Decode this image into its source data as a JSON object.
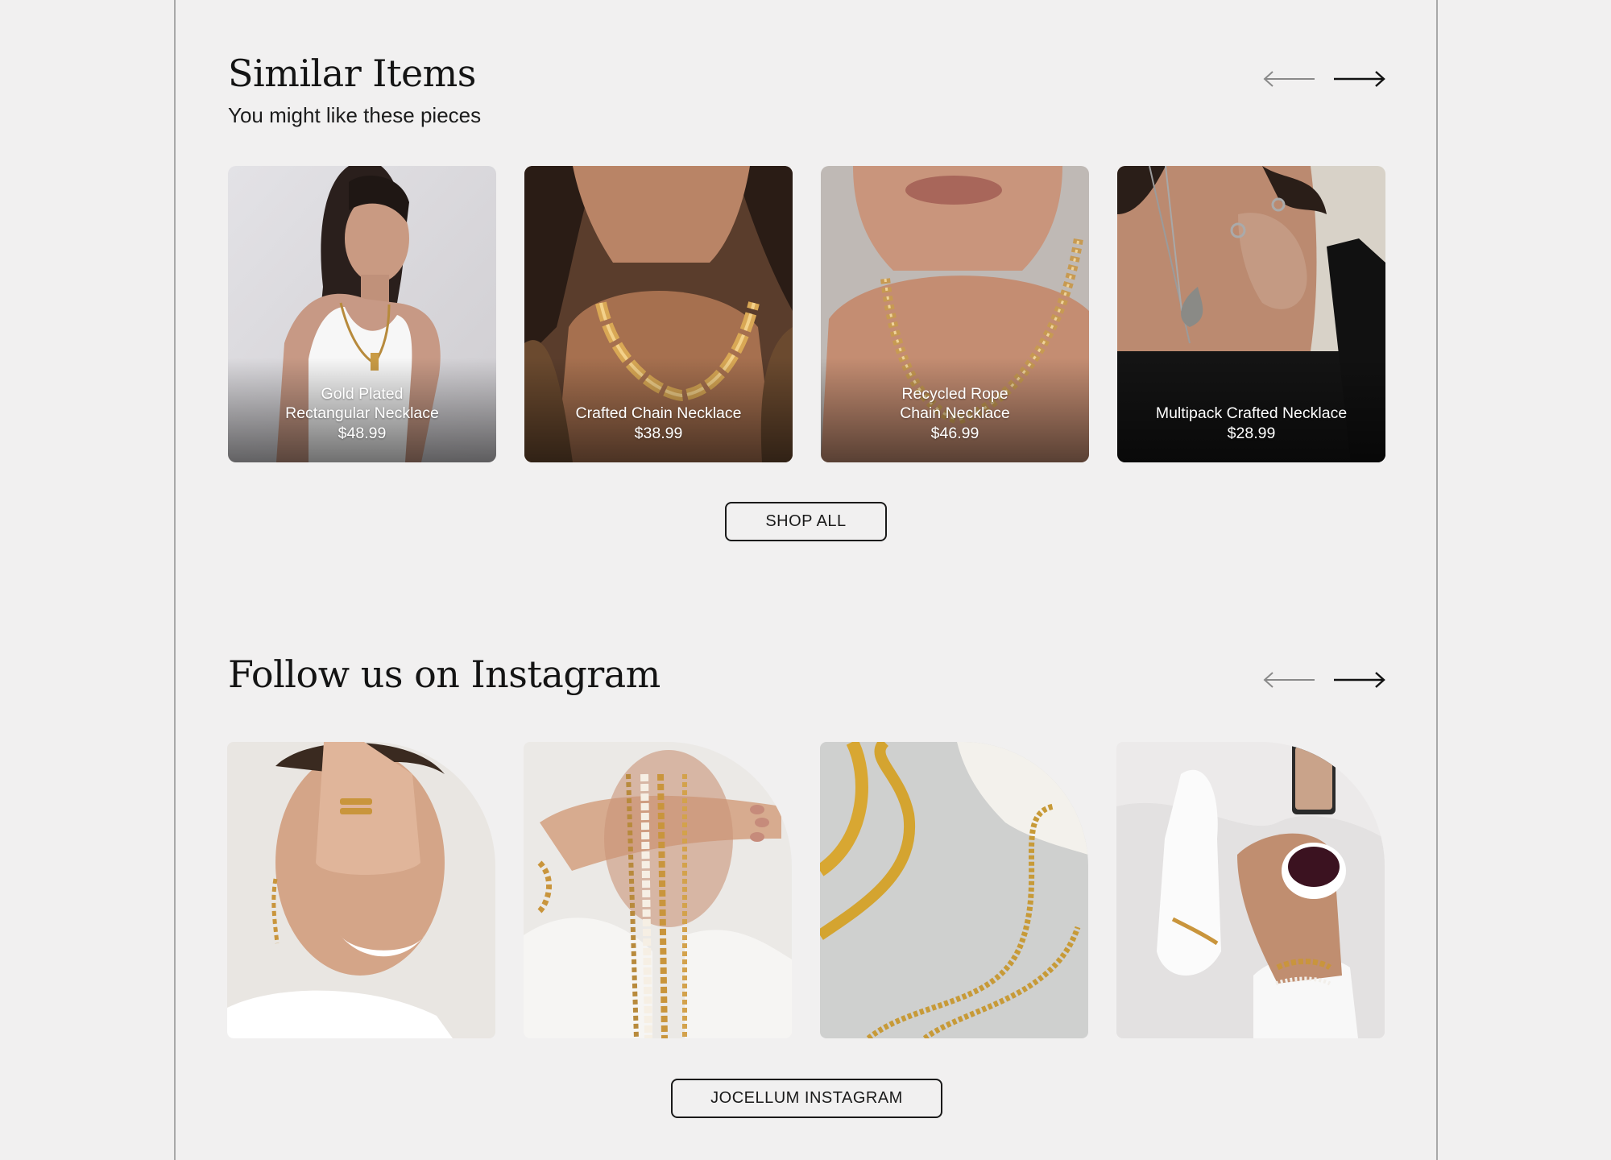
{
  "similar": {
    "title": "Similar Items",
    "subtitle": "You might like these pieces",
    "prev_icon": "arrow-left-icon",
    "next_icon": "arrow-right-icon",
    "items": [
      {
        "name": "Gold Plated\nRectangular Necklace",
        "price": "$48.99"
      },
      {
        "name": "Crafted Chain Necklace",
        "price": "$38.99"
      },
      {
        "name": "Recycled Rope\nChain Necklace",
        "price": "$46.99"
      },
      {
        "name": "Multipack Crafted Necklace",
        "price": "$28.99"
      }
    ],
    "shop_all_label": "SHOP ALL"
  },
  "instagram": {
    "title": "Follow us on Instagram",
    "prev_icon": "arrow-left-icon",
    "next_icon": "arrow-right-icon",
    "button_label": "JOCELLUM INSTAGRAM"
  },
  "colors": {
    "background": "#f1f0f0",
    "text": "#1a1a1a",
    "divider": "#a8a8a8"
  }
}
